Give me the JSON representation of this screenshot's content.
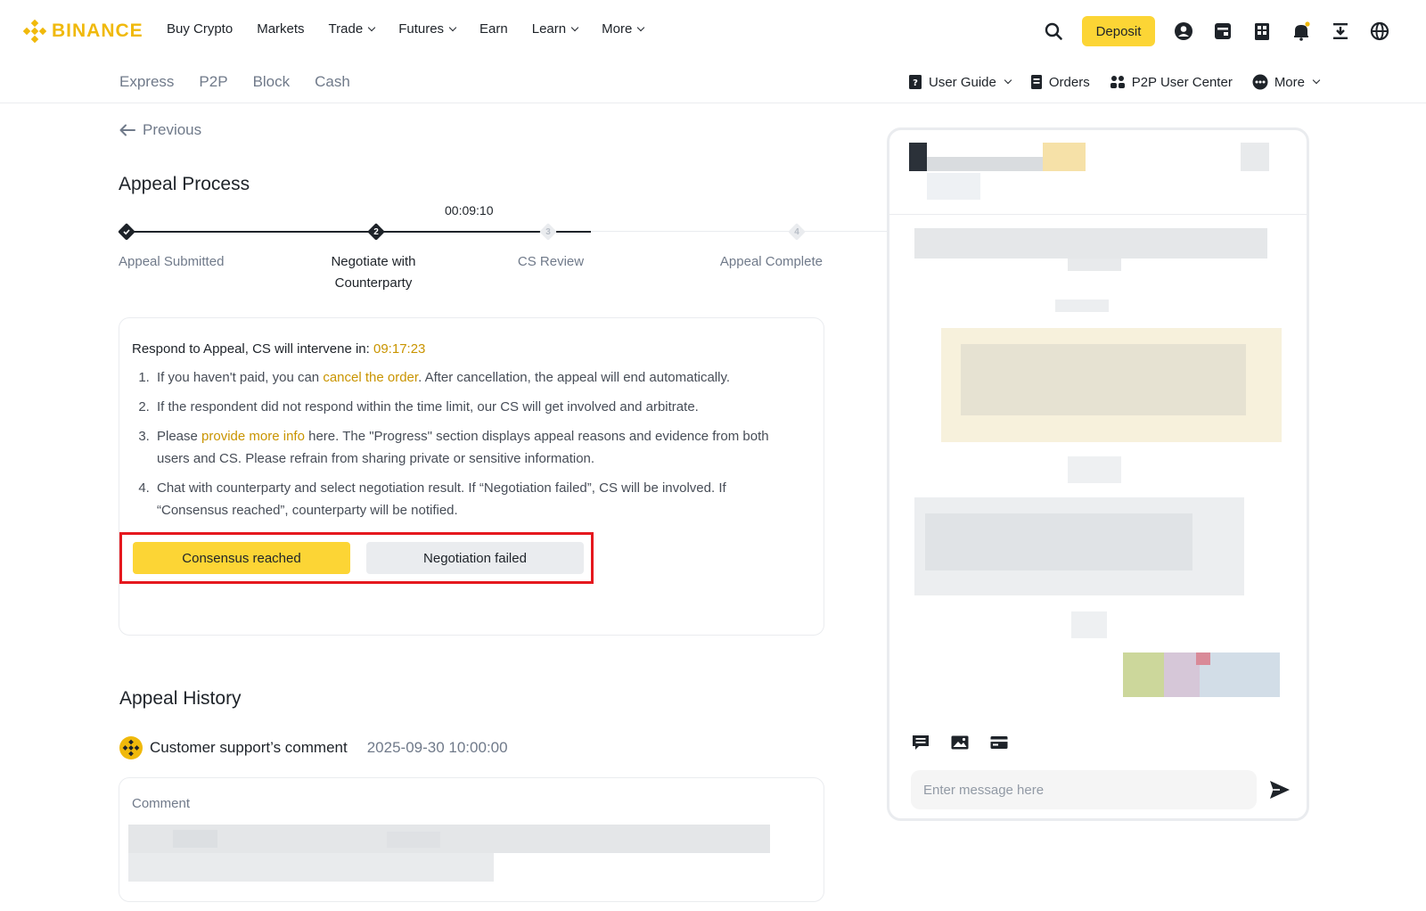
{
  "brand": {
    "name": "BINANCE",
    "color": "#f0b90b"
  },
  "topnav": {
    "links": [
      {
        "label": "Buy Crypto",
        "dropdown": false
      },
      {
        "label": "Markets",
        "dropdown": false
      },
      {
        "label": "Trade",
        "dropdown": true
      },
      {
        "label": "Futures",
        "dropdown": true
      },
      {
        "label": "Earn",
        "dropdown": false
      },
      {
        "label": "Learn",
        "dropdown": true
      },
      {
        "label": "More",
        "dropdown": true
      }
    ],
    "deposit_label": "Deposit",
    "icons": [
      "search-icon",
      "user-icon",
      "wallet-icon",
      "orders-icon",
      "bell-icon",
      "download-icon",
      "globe-icon"
    ]
  },
  "subnav": {
    "tabs": [
      "Express",
      "P2P",
      "Block",
      "Cash"
    ],
    "right": {
      "user_guide": "User Guide",
      "orders": "Orders",
      "user_center": "P2P User Center",
      "more": "More"
    }
  },
  "page": {
    "previous": "Previous",
    "title": "Appeal Process",
    "timer": "00:09:10",
    "steps": [
      {
        "label": "Appeal Submitted",
        "num": "",
        "state": "done"
      },
      {
        "label": "Negotiate with Counterparty",
        "num": "2",
        "state": "active"
      },
      {
        "label": "CS Review",
        "num": "3",
        "state": "todo"
      },
      {
        "label": "Appeal Complete",
        "num": "4",
        "state": "todo"
      }
    ],
    "respond_prefix": "Respond to Appeal, CS will intervene in:",
    "respond_countdown": "09:17:23",
    "instructions": {
      "i1_pre": "If you haven't paid, you can",
      "i1_link": "cancel the order",
      "i1_post": ". After cancellation, the appeal will end automatically.",
      "i2": "If the respondent did not respond within the time limit, our CS will get involved and arbitrate.",
      "i3_pre": "Please",
      "i3_link": "provide more info",
      "i3_post": "here. The \"Progress\" section displays appeal reasons and evidence from both users and CS. Please refrain from sharing private or sensitive information.",
      "i4": "Chat with counterparty and select negotiation result. If “Negotiation failed”, CS will be involved. If “Consensus reached”, counterparty will be notified."
    },
    "buttons": {
      "consensus": "Consensus reached",
      "failed": "Negotiation failed"
    },
    "history": {
      "title": "Appeal History",
      "author": "Customer support’s comment",
      "time": "2025-09-30 10:00:00",
      "comment_label": "Comment"
    }
  },
  "chat": {
    "placeholder": "Enter message here",
    "tools": [
      "quick-reply-icon",
      "image-upload-icon",
      "payment-card-icon"
    ]
  },
  "colors": {
    "accent": "#fcd535",
    "link": "#c99400",
    "highlight_border": "#e5181e"
  }
}
